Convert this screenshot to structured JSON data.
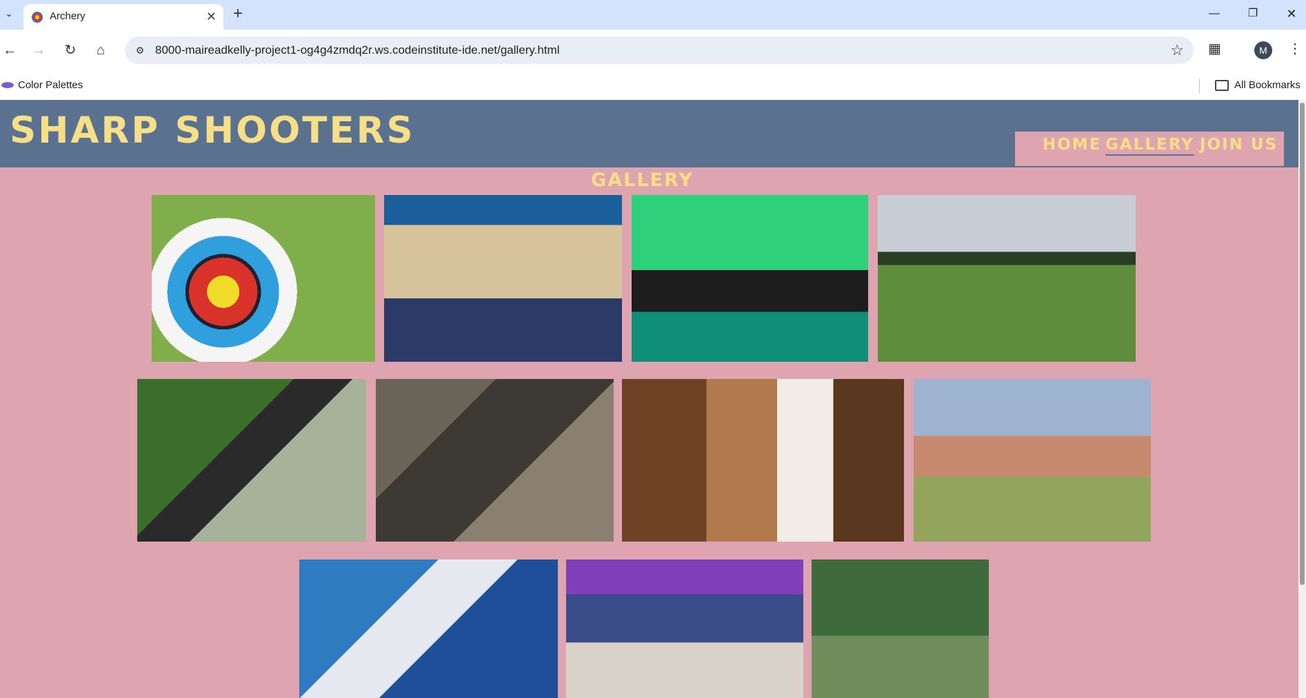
{
  "browser": {
    "tab_title": "Archery",
    "url": "8000-maireadkelly-project1-og4g4zmdq2r.ws.codeinstitute-ide.net/gallery.html",
    "profile_initial": "M",
    "bookmarks": [
      {
        "label": "Color Palettes"
      }
    ],
    "all_bookmarks_label": "All Bookmarks"
  },
  "site": {
    "brand": "SHARP SHOOTERS",
    "nav": {
      "home": "HOME",
      "gallery": "GALLERY",
      "join": "JOIN US"
    },
    "gallery_title": "GALLERY"
  },
  "colors": {
    "header_bg": "#5a7290",
    "page_bg": "#dea4b0",
    "accent_text": "#f7df88"
  }
}
